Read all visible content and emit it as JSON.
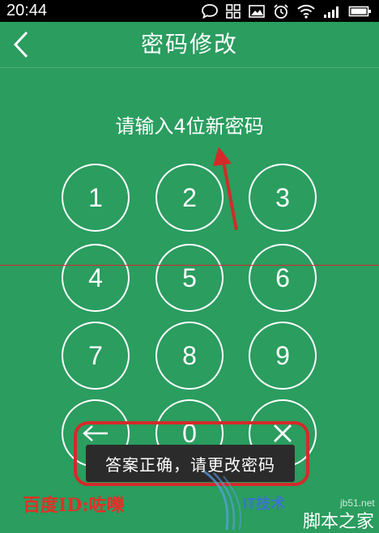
{
  "status_bar": {
    "time": "20:44",
    "icons": [
      "chat-icon",
      "grid-icon",
      "image-icon",
      "alarm-icon",
      "wifi-icon",
      "signal-icon",
      "battery-icon"
    ]
  },
  "header": {
    "back_icon": "chevron-left-icon",
    "title": "密码修改"
  },
  "prompt": "请输入4位新密码",
  "keypad": {
    "keys": [
      "1",
      "2",
      "3",
      "4",
      "5",
      "6",
      "7",
      "8",
      "9",
      "0"
    ],
    "delete_icon": "arrow-left-icon",
    "clear_icon": "close-icon"
  },
  "toast": "答案正确，请更改密码",
  "annotation": {
    "credit": "百度ID:咗嚛",
    "color": "#d42a2a"
  },
  "watermark": {
    "brand": "IT技术",
    "site": "jb51.net",
    "text": "脚本之家"
  },
  "colors": {
    "background": "#2a9d5f",
    "status_bar": "#000000",
    "toast": "#2b2b2b",
    "annotation_red": "#d42a2a"
  }
}
